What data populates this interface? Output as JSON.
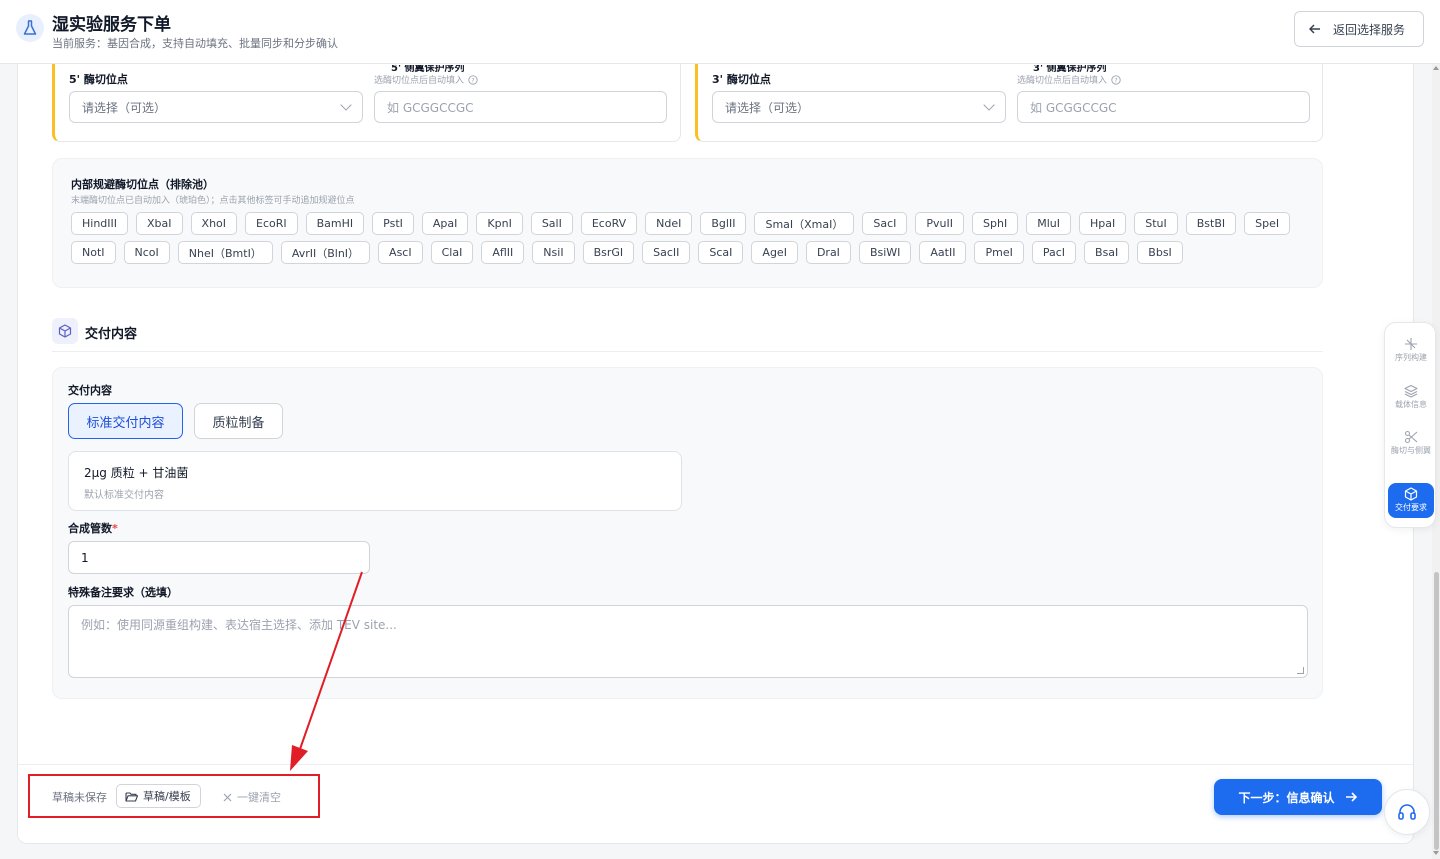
{
  "header": {
    "title": "湿实验服务下单",
    "subtitle": "当前服务：基因合成，支持自动填充、批量同步和分步确认",
    "back_label": "返回选择服务",
    "logo_icon": "flask-icon",
    "back_icon": "arrow-left-icon"
  },
  "enzyme_panels": {
    "five_prime": {
      "label": "5' 酶切位点",
      "select_placeholder": "请选择（可选）",
      "hint": "选酶切位点后自动填入",
      "input_placeholder": "如 GCGGCCGC"
    },
    "three_prime": {
      "label": "3' 酶切位点",
      "select_placeholder": "请选择（可选）",
      "hint": "选酶切位点后自动填入",
      "input_placeholder": "如 GCGGCCGC"
    }
  },
  "exclusion_pool": {
    "title": "内部规避酶切位点（排除池）",
    "hint": "末端酶切位点已自动加入（琥珀色）；点击其他标签可手动追加规避位点",
    "enzymes": [
      "HindIII",
      "XbaI",
      "XhoI",
      "EcoRI",
      "BamHI",
      "PstI",
      "ApaI",
      "KpnI",
      "SalI",
      "EcoRV",
      "NdeI",
      "BglII",
      "SmaI（XmaI）",
      "SacI",
      "PvuII",
      "SphI",
      "MluI",
      "HpaI",
      "StuI",
      "BstBI",
      "SpeI",
      "NotI",
      "NcoI",
      "NheI（BmtI）",
      "AvrII（BlnI）",
      "AscI",
      "ClaI",
      "AflII",
      "NsiI",
      "BsrGI",
      "SacII",
      "ScaI",
      "AgeI",
      "DraI",
      "BsiWI",
      "AatII",
      "PmeI",
      "PacI",
      "BsaI",
      "BbsI"
    ]
  },
  "delivery": {
    "section_title": "交付内容",
    "section_icon": "cube-icon",
    "content_label": "交付内容",
    "tabs": [
      {
        "label": "标准交付内容",
        "active": true
      },
      {
        "label": "质粒制备",
        "active": false
      }
    ],
    "info_main": "2μg 质粒 + 甘油菌",
    "info_sub": "默认标准交付内容",
    "quantity_label": "合成管数",
    "quantity_required": "*",
    "quantity_value": "1",
    "note_label": "特殊备注要求（选填）",
    "note_placeholder": "例如：使用同源重组构建、表达宿主选择、添加 TEV site..."
  },
  "bottom_bar": {
    "draft_status": "草稿未保存",
    "draft_button": "草稿/模板",
    "clear_button": "一键清空",
    "next_button": "下一步：信息确认"
  },
  "side_nav": {
    "items": [
      {
        "label": "序列构建",
        "icon": "sparkle-icon",
        "active": false
      },
      {
        "label": "载体信息",
        "icon": "layers-icon",
        "active": false
      },
      {
        "label": "酶切与侧翼",
        "icon": "scissors-icon",
        "active": false
      },
      {
        "label": "交付要求",
        "icon": "cube-icon",
        "active": true
      }
    ]
  },
  "colors": {
    "primary": "#1d6cf0",
    "amber_accent": "#fbbf24",
    "annotation_red": "#e11d26"
  }
}
